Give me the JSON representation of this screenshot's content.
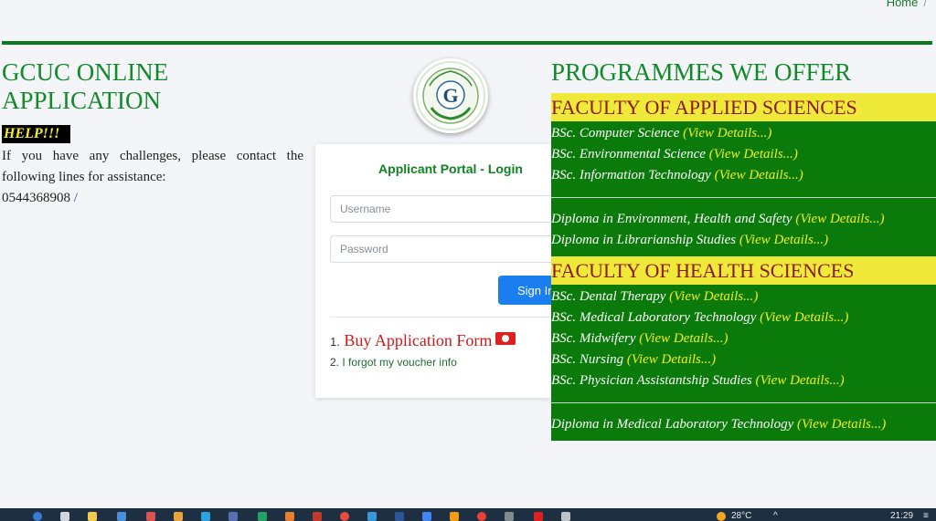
{
  "breadcrumb": {
    "home": "Home",
    "separator": "/"
  },
  "left": {
    "title_line1": "GCUC ONLINE",
    "title_line2": "APPLICATION",
    "help_badge": "HELP!!!",
    "help_text": "If you have any challenges, please contact the following lines for assistance:",
    "phone": "0544368908",
    "phone_sep": "/"
  },
  "logo": {
    "name": "garden-city-university-college-logo",
    "letter": "G"
  },
  "login": {
    "title": "Applicant Portal - Login",
    "username_placeholder": "Username",
    "password_placeholder": "Password",
    "signin_label": "Sign In",
    "links": [
      {
        "num": "1.",
        "label": "Buy Application Form"
      },
      {
        "num": "2.",
        "label": "I forgot my voucher info"
      }
    ]
  },
  "programmes": {
    "title": "PROGRAMMES WE OFFER",
    "view_details": "(View Details...)",
    "faculties": [
      {
        "name": "FACULTY OF APPLIED SCIENCES",
        "degrees": [
          "BSc. Computer Science",
          "BSc. Environmental Science",
          "BSc. Information Technology"
        ],
        "diplomas": [
          "Diploma in Environment, Health and Safety",
          "Diploma in Librarianship Studies"
        ]
      },
      {
        "name": "FACULTY OF HEALTH SCIENCES",
        "degrees": [
          "BSc. Dental Therapy",
          "BSc. Medical Laboratory Technology",
          "BSc. Midwifery",
          "BSc. Nursing",
          "BSc. Physician Assistantship Studies"
        ],
        "diplomas": [
          "Diploma in Medical Laboratory Technology"
        ]
      }
    ]
  },
  "taskbar": {
    "temperature": "28°C",
    "time": "21:29"
  },
  "colors": {
    "brand_green": "#128a28",
    "programme_bg": "#0a7a0a",
    "faculty_head_bg": "#efe93a",
    "details_yellow": "#f2ee20",
    "signin_blue": "#1a7ef0"
  }
}
